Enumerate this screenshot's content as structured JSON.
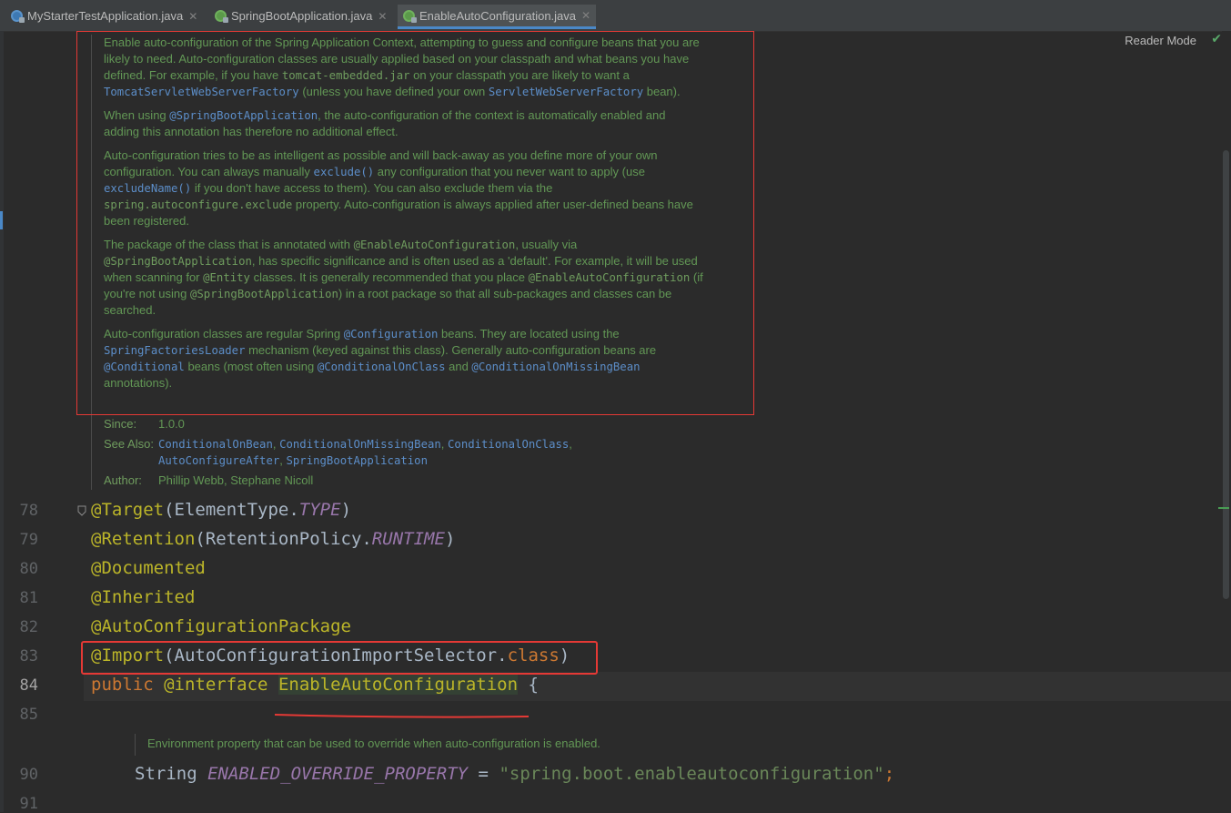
{
  "tabs": [
    {
      "label": "MyStarterTestApplication.java",
      "active": false
    },
    {
      "label": "SpringBootApplication.java",
      "active": false
    },
    {
      "label": "EnableAutoConfiguration.java",
      "active": true
    }
  ],
  "reader_mode": "Reader Mode",
  "doc": {
    "p1": {
      "t1": "Enable auto-configuration of the Spring Application Context, attempting to guess and configure beans that you are likely to need. Auto-configuration classes are usually applied based on your classpath and what beans you have defined. For example, if you have ",
      "c1": "tomcat-embedded.jar",
      "t2": " on your classpath you are likely to want a ",
      "c2": "TomcatServletWebServerFactory",
      "t3": " (unless you have defined your own ",
      "c3": "ServletWebServerFactory",
      "t4": " bean)."
    },
    "p2": {
      "t1": "When using ",
      "c1": "@SpringBootApplication",
      "t2": ", the auto-configuration of the context is automatically enabled and adding this annotation has therefore no additional effect."
    },
    "p3": {
      "t1": "Auto-configuration tries to be as intelligent as possible and will back-away as you define more of your own configuration. You can always manually ",
      "c1": "exclude()",
      "t2": " any configuration that you never want to apply (use ",
      "c2": "excludeName()",
      "t3": " if you don't have access to them). You can also exclude them via the ",
      "c3": "spring.autoconfigure.exclude",
      "t4": " property. Auto-configuration is always applied after user-defined beans have been registered."
    },
    "p4": {
      "t1": "The package of the class that is annotated with ",
      "c1": "@EnableAutoConfiguration",
      "t2": ", usually via ",
      "c2": "@SpringBootApplication",
      "t3": ", has specific significance and is often used as a 'default'. For example, it will be used when scanning for ",
      "c3": "@Entity",
      "t4": " classes. It is generally recommended that you place ",
      "c4": "@EnableAutoConfiguration",
      "t5": " (if you're not using ",
      "c5": "@SpringBootApplication",
      "t6": ") in a root package so that all sub-packages and classes can be searched."
    },
    "p5": {
      "t1": "Auto-configuration classes are regular Spring ",
      "c1": "@Configuration",
      "t2": " beans. They are located using the ",
      "c2": "SpringFactoriesLoader",
      "t3": " mechanism (keyed against this class). Generally auto-configuration beans are ",
      "c3": "@Conditional",
      "t4": " beans (most often using ",
      "c4": "@ConditionalOnClass",
      "t5": " and ",
      "c5": "@ConditionalOnMissingBean",
      "t6": " annotations)."
    },
    "since_label": "Since:",
    "since_value": "1.0.0",
    "see_also_label": "See Also:",
    "see_also": [
      "ConditionalOnBean",
      "ConditionalOnMissingBean",
      "ConditionalOnClass",
      "AutoConfigureAfter",
      "SpringBootApplication"
    ],
    "sep": ", ",
    "author_label": "Author:",
    "author_value": "Phillip Webb, Stephane Nicoll"
  },
  "code": {
    "l78": {
      "num": "78",
      "ann": "@Target",
      "p1": "(ElementType.",
      "it": "TYPE",
      "p2": ")"
    },
    "l79": {
      "num": "79",
      "ann": "@Retention",
      "p1": "(RetentionPolicy.",
      "it": "RUNTIME",
      "p2": ")"
    },
    "l80": {
      "num": "80",
      "ann": "@Documented"
    },
    "l81": {
      "num": "81",
      "ann": "@Inherited"
    },
    "l82": {
      "num": "82",
      "ann": "@AutoConfigurationPackage"
    },
    "l83": {
      "num": "83",
      "ann": "@Import",
      "p1": "(AutoConfigurationImportSelector.",
      "kw": "class",
      "p2": ")"
    },
    "l84": {
      "num": "84",
      "kw1": "public",
      "ann": "@interface",
      "name": "EnableAutoConfiguration",
      "p2": "{"
    },
    "l85": {
      "num": "85"
    },
    "env_doc": "Environment property that can be used to override when auto-configuration is enabled.",
    "l90": {
      "num": "90",
      "type": "String",
      "it": "ENABLED_OVERRIDE_PROPERTY",
      "eq": "=",
      "str": "\"spring.boot.enableautoconfiguration\"",
      "semi": ";"
    },
    "l91": {
      "num": "91"
    }
  }
}
